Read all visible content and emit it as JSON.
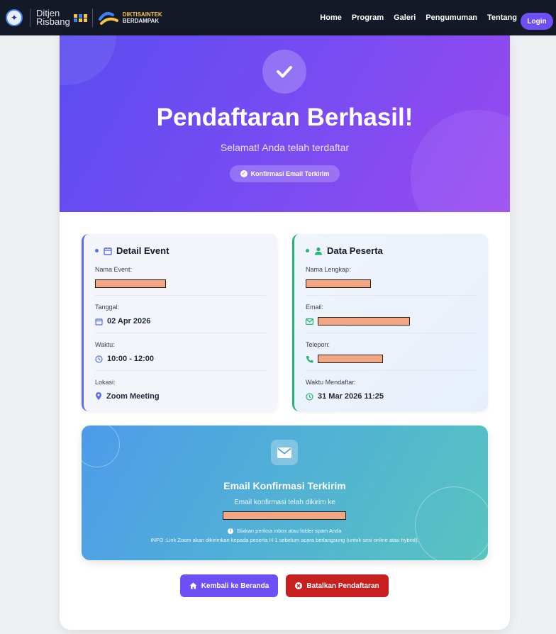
{
  "navbar": {
    "brand_line1": "Ditjen",
    "brand_line2": "Risbang",
    "brand2_line1": "DIKTISAINTEK",
    "brand2_line2": "BERDAMPAK",
    "links": [
      "Home",
      "Program",
      "Galeri",
      "Pengumuman",
      "Tentang"
    ],
    "login_label": "Login"
  },
  "hero": {
    "title": "Pendaftaran Berhasil!",
    "subtitle": "Selamat! Anda telah terdaftar",
    "badge": "Konfirmasi Email Terkirim"
  },
  "event": {
    "heading": "Detail Event",
    "name_label": "Nama Event:",
    "date_label": "Tanggal:",
    "date_value": "02 Apr 2026",
    "time_label": "Waktu:",
    "time_value": "10:00 - 12:00",
    "location_label": "Lokasi:",
    "location_value": "Zoom Meeting"
  },
  "participant": {
    "heading": "Data Peserta",
    "fullname_label": "Nama Lengkap:",
    "email_label": "Email:",
    "phone_label": "Telepon:",
    "registered_label": "Waktu Mendaftar:",
    "registered_value": "31 Mar 2026 11:25"
  },
  "email_panel": {
    "title": "Email Konfirmasi Terkirim",
    "subtitle": "Email konfirmasi telah dikirim ke",
    "note": "Silakan periksa inbox atau folder spam Anda",
    "info": "INFO :Link Zoom akan dikirimkan kepada peserta H-1 sebelum acara berlangsung (untuk sesi online atau hybrid)."
  },
  "actions": {
    "home_label": "Kembali ke Beranda",
    "cancel_label": "Batalkan Pendaftaran"
  },
  "colors": {
    "hero_start": "#5b4cf0",
    "hero_end": "#9a49f0",
    "event_accent": "#5b6cf0",
    "participant_accent": "#22b573",
    "primary_button": "#6d4ff5",
    "danger_button": "#c8201f",
    "redaction": "#f4a582"
  }
}
